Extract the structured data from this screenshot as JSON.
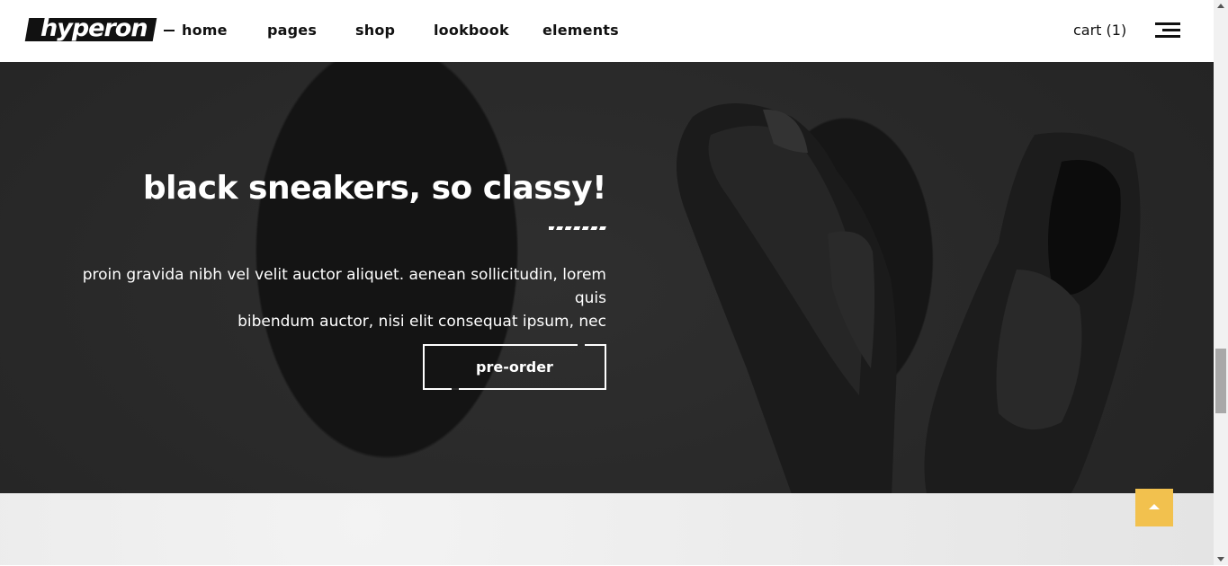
{
  "header": {
    "logo": "hyperon",
    "nav": [
      "home",
      "pages",
      "shop",
      "lookbook",
      "elements"
    ],
    "cart": "cart (1)"
  },
  "hero": {
    "title": "black sneakers, so classy!",
    "text_line1": "proin gravida nibh vel velit auctor aliquet. aenean sollicitudin, lorem quis",
    "text_line2": "bibendum auctor, nisi elit consequat ipsum, nec",
    "button": "pre-order"
  },
  "colors": {
    "accent": "#f2c14e",
    "dark": "#111111"
  },
  "icons": [
    "hamburger-menu-icon",
    "arrow-up-icon"
  ]
}
